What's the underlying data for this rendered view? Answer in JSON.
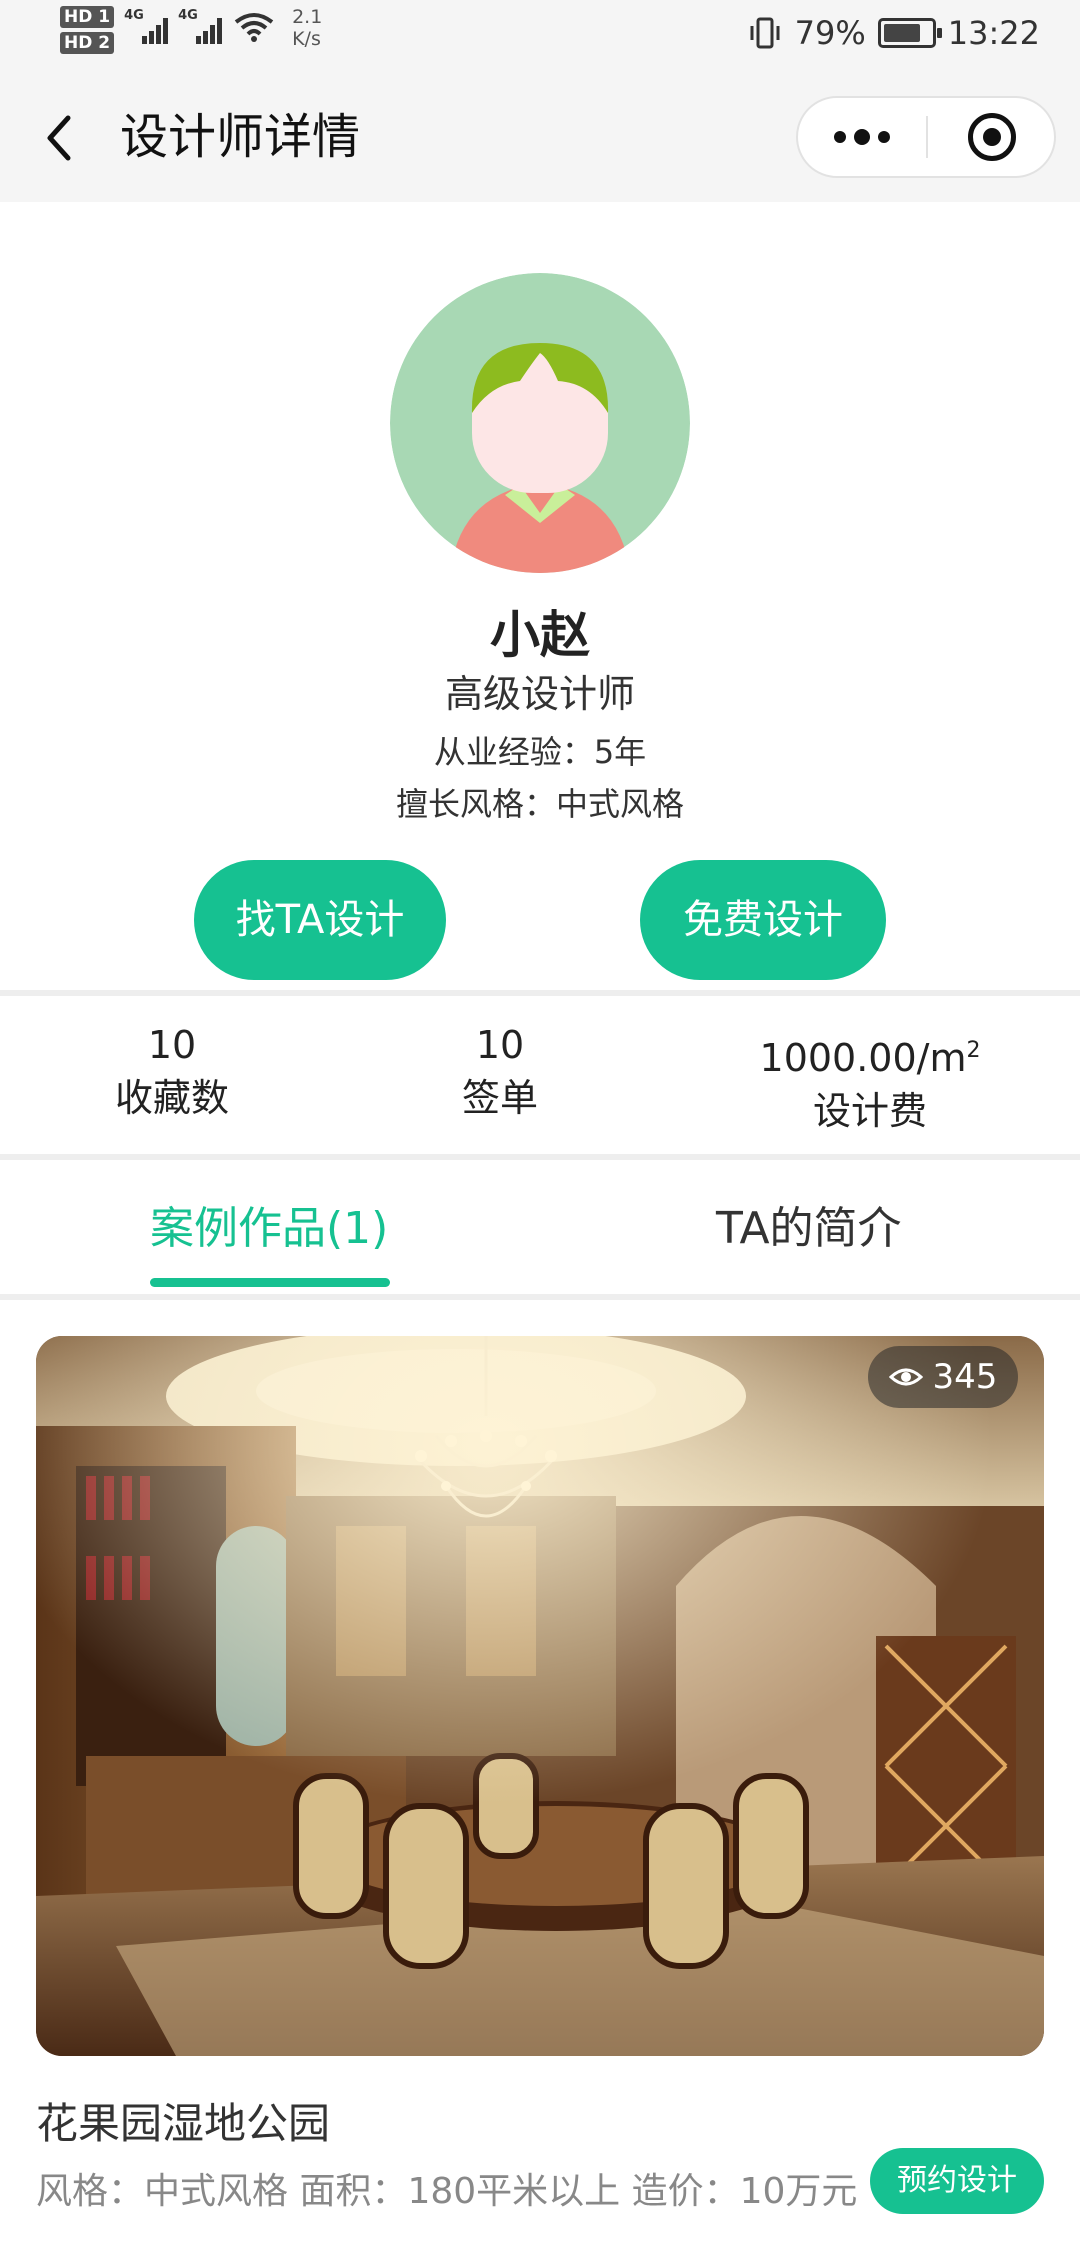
{
  "status_bar": {
    "hd_labels": [
      "HD 1",
      "HD 2"
    ],
    "network": [
      "4G",
      "4G"
    ],
    "speed_value": "2.1",
    "speed_unit": "K/s",
    "battery_percent": "79%",
    "battery_level": 0.79,
    "time": "13:22"
  },
  "nav": {
    "title": "设计师详情",
    "back_icon": "chevron-left-icon",
    "more_icon": "more-dots-icon",
    "close_icon": "target-icon"
  },
  "designer": {
    "name": "小赵",
    "level": "高级设计师",
    "experience": "从业经验：5年",
    "style": "擅长风格：中式风格"
  },
  "actions": {
    "find_designer": "找TA设计",
    "free_design": "免费设计"
  },
  "stats": [
    {
      "value": "10",
      "label": "收藏数"
    },
    {
      "value": "10",
      "label": "签单"
    },
    {
      "value": "1000.00/m",
      "superscript": "2",
      "label": "设计费"
    }
  ],
  "tabs": [
    {
      "label": "案例作品(1)",
      "active": true
    },
    {
      "label": "TA的简介",
      "active": false
    }
  ],
  "case": {
    "views": "345",
    "title": "花果园湿地公园",
    "meta": "风格：中式风格 面积：180平米以上 造价：10万元",
    "book_label": "预约设计"
  },
  "colors": {
    "accent": "#16c191",
    "background": "#ffffff",
    "nav_background": "#f5f5f5"
  }
}
